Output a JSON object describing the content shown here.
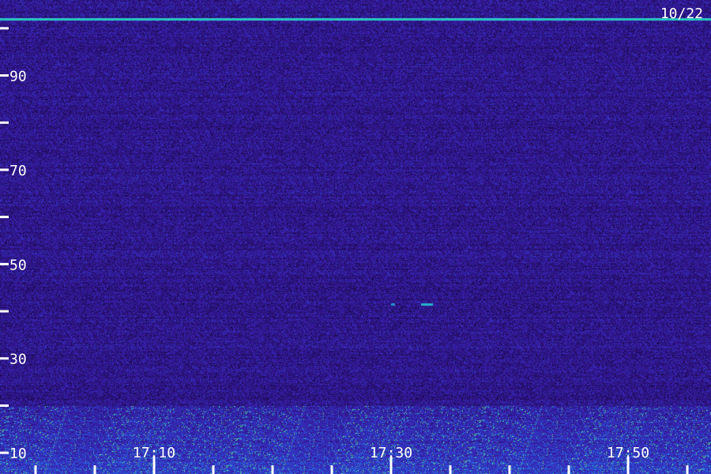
{
  "chart_data": {
    "type": "heatmap",
    "date_label": "10/22",
    "xlabel": "",
    "ylabel": "",
    "x_ticks": [
      {
        "value": "17:00",
        "label": ""
      },
      {
        "value": "17:05",
        "label": ""
      },
      {
        "value": "17:10",
        "label": "17:10"
      },
      {
        "value": "17:15",
        "label": ""
      },
      {
        "value": "17:20",
        "label": ""
      },
      {
        "value": "17:25",
        "label": ""
      },
      {
        "value": "17:30",
        "label": "17:30"
      },
      {
        "value": "17:35",
        "label": ""
      },
      {
        "value": "17:40",
        "label": ""
      },
      {
        "value": "17:45",
        "label": ""
      },
      {
        "value": "17:50",
        "label": "17:50"
      },
      {
        "value": "17:55",
        "label": ""
      }
    ],
    "y_ticks": [
      {
        "value": 10,
        "label": "10"
      },
      {
        "value": 20,
        "label": ""
      },
      {
        "value": 30,
        "label": "30"
      },
      {
        "value": 40,
        "label": ""
      },
      {
        "value": 50,
        "label": "50"
      },
      {
        "value": 60,
        "label": ""
      },
      {
        "value": 70,
        "label": "70"
      },
      {
        "value": 80,
        "label": ""
      },
      {
        "value": 90,
        "label": "90"
      },
      {
        "value": 100,
        "label": ""
      }
    ],
    "xlim": [
      "16:57",
      "17:57"
    ],
    "ylim": [
      5.5,
      106
    ],
    "colormap": [
      "#1a0a4a",
      "#3a1aa8",
      "#2a5ae0",
      "#22c8c8",
      "#7cf07c"
    ],
    "features": [
      {
        "name": "strong carrier line",
        "y": 102,
        "intensity": "high"
      },
      {
        "name": "low-frequency noise band",
        "y_range": [
          8,
          20
        ],
        "intensity": "high"
      },
      {
        "name": "weak signal",
        "y": 41.5,
        "x": "17:33",
        "intensity": "medium"
      }
    ]
  }
}
